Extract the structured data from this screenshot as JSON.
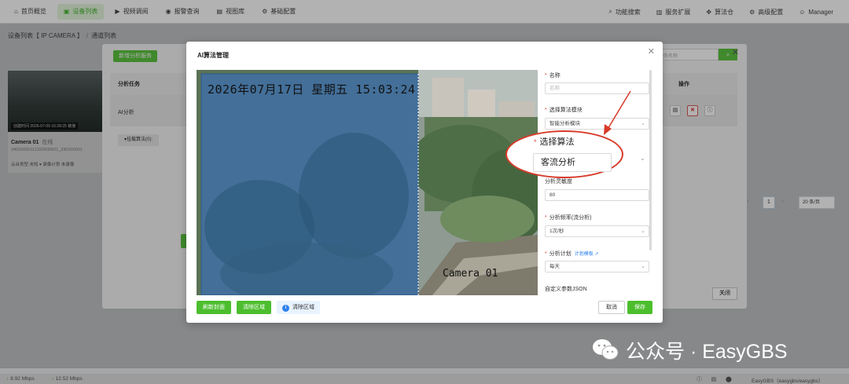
{
  "nav": {
    "left": [
      {
        "icon": "home-icon",
        "glyph": "⌂",
        "label": "首页概览"
      },
      {
        "icon": "device-icon",
        "glyph": "▣",
        "label": "设备列表",
        "active": true
      },
      {
        "icon": "video-icon",
        "glyph": "▶",
        "label": "视频调阅"
      },
      {
        "icon": "alarm-icon",
        "glyph": "◉",
        "label": "报警查询"
      },
      {
        "icon": "image-icon",
        "glyph": "▤",
        "label": "视图库"
      },
      {
        "icon": "settings-icon",
        "glyph": "⚙",
        "label": "基础配置"
      }
    ],
    "right": [
      {
        "icon": "search-icon",
        "glyph": "⌕",
        "label": "功能搜索"
      },
      {
        "icon": "server-icon",
        "glyph": "▥",
        "label": "服务扩展"
      },
      {
        "icon": "algorithm-icon",
        "glyph": "✥",
        "label": "算法仓"
      },
      {
        "icon": "gear-icon",
        "glyph": "⚙",
        "label": "高级配置"
      },
      {
        "icon": "user-icon",
        "glyph": "☺",
        "label": "Manager"
      }
    ]
  },
  "breadcrumb": {
    "first": "设备列表【 IP CAMERA 】",
    "sep": "/",
    "second": "通道列表"
  },
  "card": {
    "badge": "创建时间 2026-07-09 16:28:25",
    "badge2": "链接",
    "name": "Camera 01",
    "status": "在线",
    "id": "34020000111320000001_340200001",
    "tags": "云台类型 未知 ▾    录像计划 未录像"
  },
  "drawer": {
    "add_button": "新增分析服务",
    "search_placeholder": "请输入服务名称",
    "col_task": "分析任务",
    "col_ops": "操作",
    "row_task": "AI分析",
    "mount_button": "▾挂载算法(0):",
    "page": "1",
    "page_size": "20 条/页",
    "close_button": "关闭"
  },
  "modal": {
    "title": "AI算法管理",
    "video": {
      "timestamp": "2026年07月17日  星期五  15:03:24",
      "camera_label": "Camera 01"
    },
    "buttons": {
      "refresh": "刷新封面",
      "clear_region": "清除区域",
      "info": "清除区域",
      "cancel": "取消",
      "save": "保存"
    },
    "form": {
      "name_label": "名称",
      "name_placeholder": "名称",
      "module_label": "选择算法模块",
      "module_value": "智能分析模块",
      "algorithm_label": "选择算法",
      "algorithm_value": "客流分析",
      "sensitivity_label": "分析灵敏度",
      "sensitivity_value": "80",
      "frequency_label": "分析频率(流分析)",
      "frequency_value": "1次/秒",
      "plan_label": "分析计划",
      "plan_link": "计划模板",
      "plan_value": "每天",
      "json_label": "自定义参数JSON"
    }
  },
  "status": {
    "up": "8.92 Mbps",
    "down": "12.52 Mbps",
    "version": "EasyGBS（easygbs/easygbs）"
  },
  "watermark": "公众号 · EasyGBS",
  "colors": {
    "accent": "#4cbe2e",
    "danger": "#d83a2a",
    "link": "#2f80ed"
  }
}
